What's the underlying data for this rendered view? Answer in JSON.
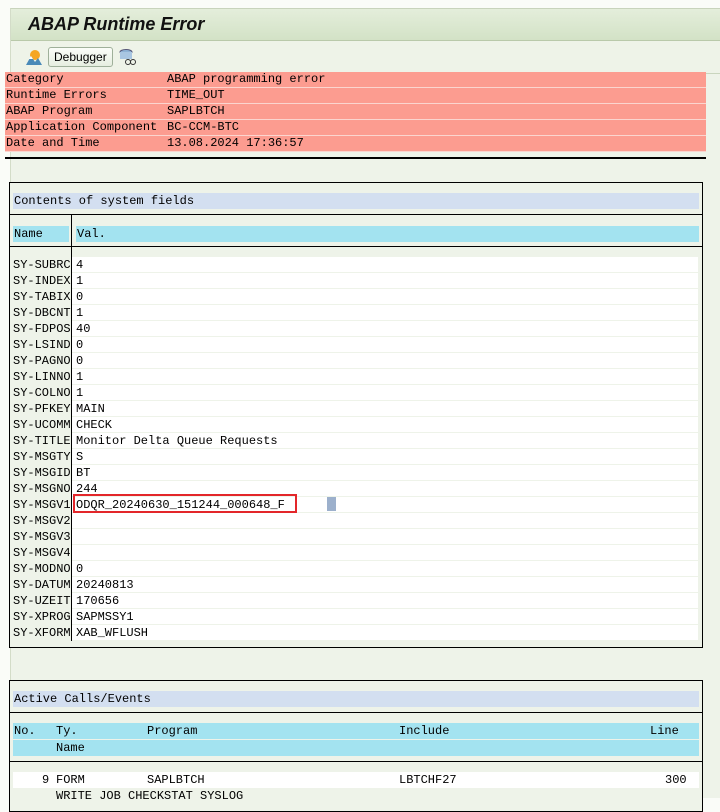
{
  "title": "ABAP Runtime Error",
  "toolbar": {
    "debugger_label": "Debugger"
  },
  "header_rows": [
    {
      "key": "Category",
      "value": "ABAP programming error"
    },
    {
      "key": "Runtime Errors",
      "value": "TIME_OUT"
    },
    {
      "key": "ABAP Program",
      "value": "SAPLBTCH"
    },
    {
      "key": "Application Component",
      "value": "BC-CCM-BTC"
    },
    {
      "key": "Date and Time",
      "value": "13.08.2024 17:36:57"
    }
  ],
  "system_fields": {
    "title": "Contents of system fields",
    "col_name": "Name",
    "col_val": "Val.",
    "rows": [
      {
        "n": "SY-SUBRC",
        "v": "4"
      },
      {
        "n": "SY-INDEX",
        "v": "1"
      },
      {
        "n": "SY-TABIX",
        "v": "0"
      },
      {
        "n": "SY-DBCNT",
        "v": "1"
      },
      {
        "n": "SY-FDPOS",
        "v": "40"
      },
      {
        "n": "SY-LSIND",
        "v": "0"
      },
      {
        "n": "SY-PAGNO",
        "v": "0"
      },
      {
        "n": "SY-LINNO",
        "v": "1"
      },
      {
        "n": "SY-COLNO",
        "v": "1"
      },
      {
        "n": "SY-PFKEY",
        "v": "MAIN"
      },
      {
        "n": "SY-UCOMM",
        "v": "CHECK"
      },
      {
        "n": "SY-TITLE",
        "v": "Monitor Delta Queue Requests"
      },
      {
        "n": "SY-MSGTY",
        "v": "S"
      },
      {
        "n": "SY-MSGID",
        "v": "BT"
      },
      {
        "n": "SY-MSGNO",
        "v": "244"
      },
      {
        "n": "SY-MSGV1",
        "v": "ODQR_20240630_151244_000648_F"
      },
      {
        "n": "SY-MSGV2",
        "v": ""
      },
      {
        "n": "SY-MSGV3",
        "v": ""
      },
      {
        "n": "SY-MSGV4",
        "v": ""
      },
      {
        "n": "SY-MODNO",
        "v": "0"
      },
      {
        "n": "SY-DATUM",
        "v": "20240813"
      },
      {
        "n": "SY-UZEIT",
        "v": "170656"
      },
      {
        "n": "SY-XPROG",
        "v": "SAPMSSY1"
      },
      {
        "n": "SY-XFORM",
        "v": "XAB_WFLUSH"
      }
    ]
  },
  "active_calls": {
    "title": "Active Calls/Events",
    "cols": {
      "no": "No.",
      "ty": "Ty.",
      "program": "Program",
      "include": "Include",
      "line": "Line",
      "name": "Name"
    },
    "rows": [
      {
        "no": "9",
        "ty": "FORM",
        "program": "SAPLBTCH",
        "include": "LBTCHF27",
        "line": "300",
        "name": "WRITE JOB CHECKSTAT SYSLOG"
      }
    ]
  }
}
